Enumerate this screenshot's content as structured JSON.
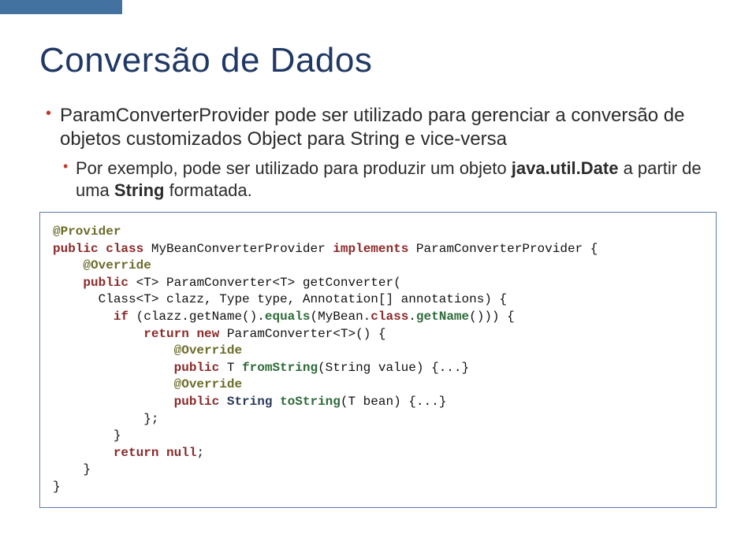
{
  "title": "Conversão de Dados",
  "bullets": [
    "ParamConverterProvider pode ser utilizado para gerenciar a conversão de objetos customizados Object para String e vice-versa",
    {
      "p1": "Por exemplo, pode ser utilizado para produzir um objeto ",
      "b1": "java.util.Date",
      "p2": " a partir de uma ",
      "b2": "String",
      "p3": " formatada."
    }
  ],
  "code": {
    "l1a": "@Provider",
    "kw_public": "public",
    "kw_class": "class",
    "l2a": "MyBeanConverterProvider",
    "kw_implements": "implements",
    "l2b": "ParamConverterProvider {",
    "kw_override": "@Override",
    "l4": "<T> ParamConverter<T> getConverter(",
    "l5": "Class<T> clazz, Type type, Annotation[] annotations) {",
    "kw_if": "if",
    "l6a": "(clazz.getName().",
    "kw_equals": "equals",
    "l6b": "(MyBean.",
    "l6c": ".",
    "kw_getName": "getName",
    "l6d": "())) {",
    "kw_return": "return",
    "kw_new": "new",
    "l7": "ParamConverter<T>() {",
    "l9a": "T ",
    "kw_fromString": "fromString",
    "l9b": "(String value) {...}",
    "kw_String": "String",
    "l11a": "",
    "kw_toString": "toString",
    "l11b": "(T bean) {...}",
    "l12": "};",
    "l13": "}",
    "kw_null": "null",
    "l14": ";",
    "l15": "}",
    "l16": "}"
  }
}
